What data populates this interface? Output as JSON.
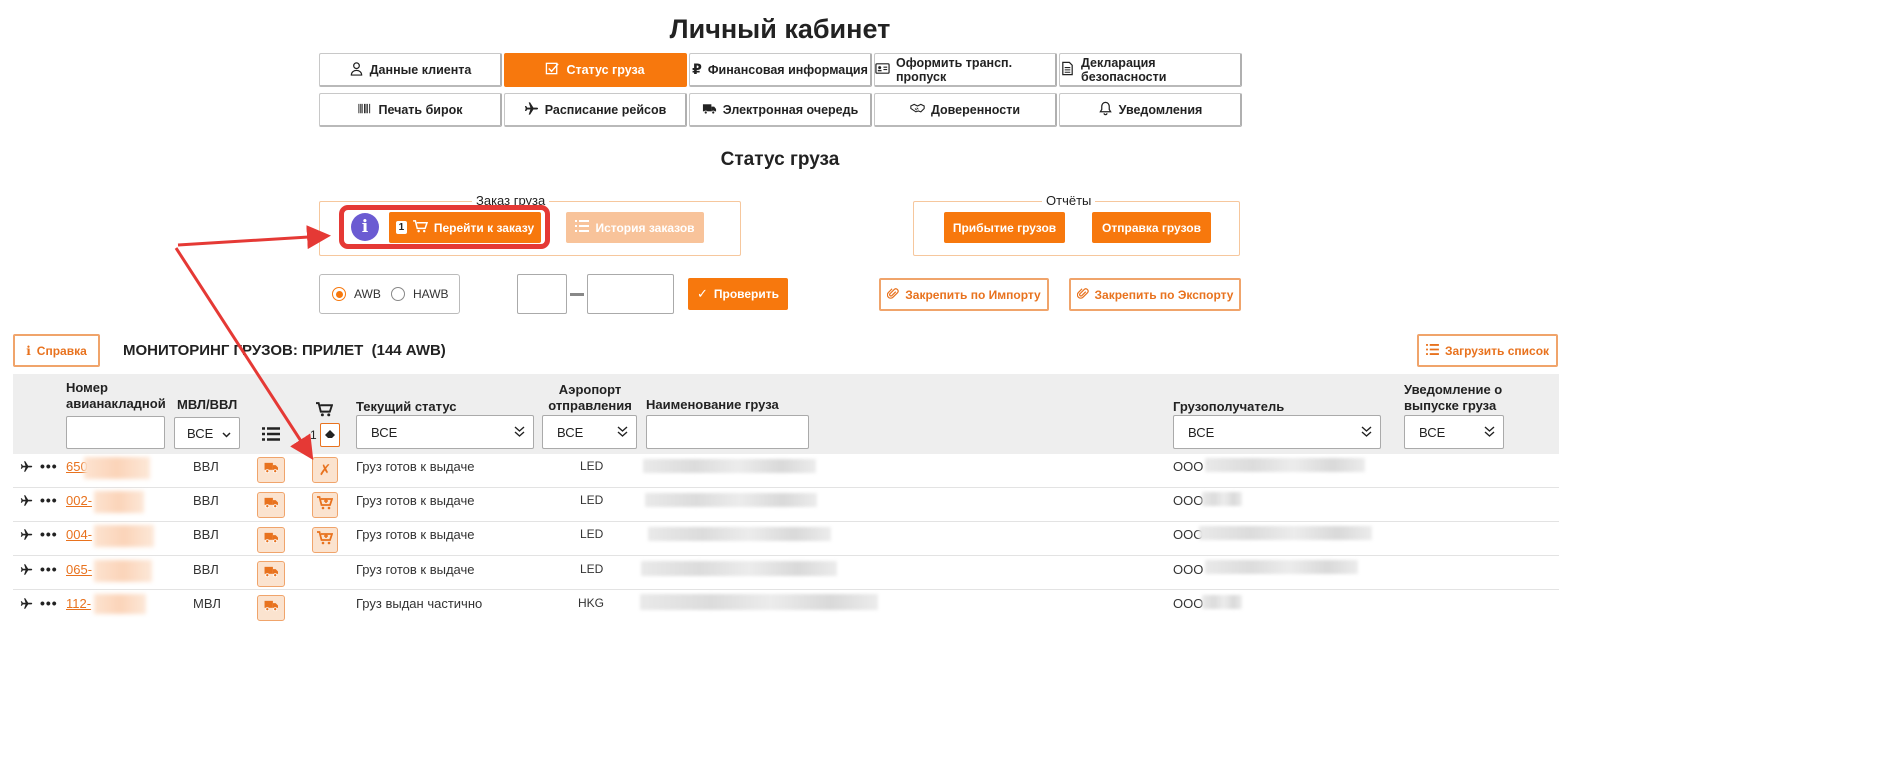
{
  "page": {
    "title": "Личный кабинет",
    "section_title": "Статус груза"
  },
  "tabs": [
    {
      "label": "Данные клиента",
      "icon": "user-icon",
      "active": false
    },
    {
      "label": "Статус груза",
      "icon": "checkbox-icon",
      "active": true
    },
    {
      "label": "Финансовая информация",
      "icon": "ruble-icon",
      "active": false
    },
    {
      "label": "Оформить трансп. пропуск",
      "icon": "id-card-icon",
      "active": false
    },
    {
      "label": "Декларация безопасности",
      "icon": "document-icon",
      "active": false
    },
    {
      "label": "Печать бирок",
      "icon": "barcode-icon",
      "active": false
    },
    {
      "label": "Расписание рейсов",
      "icon": "plane-icon",
      "active": false
    },
    {
      "label": "Электронная очередь",
      "icon": "truck-icon",
      "active": false
    },
    {
      "label": "Доверенности",
      "icon": "handshake-icon",
      "active": false
    },
    {
      "label": "Уведомления",
      "icon": "bell-icon",
      "active": false
    }
  ],
  "order": {
    "legend": "Заказ груза",
    "badge": "1",
    "goto_label": "Перейти к заказу",
    "history_label": "История заказов"
  },
  "reports": {
    "legend": "Отчёты",
    "arrival_label": "Прибытие грузов",
    "departure_label": "Отправка грузов"
  },
  "search": {
    "radio_awb": "AWB",
    "radio_hawb": "HAWB",
    "selected": "AWB",
    "check_label": "Проверить",
    "pin_import": "Закрепить по Импорту",
    "pin_export": "Закрепить по Экспорту"
  },
  "monitor": {
    "help_label": "Справка",
    "title": "МОНИТОРИНГ ГРУЗОВ: ПРИЛЕТ  (144 AWB)",
    "load_list_label": "Загрузить список",
    "cart_count": "1"
  },
  "columns": {
    "awb": "Номер авианакладной",
    "mvl": "МВЛ/ВВЛ",
    "status": "Текущий статус",
    "airport": "Аэропорт отправления",
    "cargo_name": "Наименование груза",
    "consignee": "Грузополучатель",
    "notice": "Уведомление о выпуске груза"
  },
  "filters": {
    "mvl": "ВСЕ",
    "status": "ВСЕ",
    "airport": "ВСЕ",
    "consignee": "ВСЕ",
    "notice": "ВСЕ"
  },
  "rows": [
    {
      "awb": "650",
      "type": "ВВЛ",
      "status": "Груз готов к выдаче",
      "airport": "LED",
      "consignee": "ООО '",
      "cart": "remove"
    },
    {
      "awb": "002-",
      "type": "ВВЛ",
      "status": "Груз готов к выдаче",
      "airport": "LED",
      "consignee": "ООО",
      "cart": "add"
    },
    {
      "awb": "004-",
      "type": "ВВЛ",
      "status": "Груз готов к выдаче",
      "airport": "LED",
      "consignee": "ООО",
      "cart": "add"
    },
    {
      "awb": "065-",
      "type": "ВВЛ",
      "status": "Груз готов к выдаче",
      "airport": "LED",
      "consignee": "ООО",
      "cart": "none"
    },
    {
      "awb": "112-",
      "type": "МВЛ",
      "status": "Груз выдан частично",
      "airport": "HKG",
      "consignee": "ООО",
      "cart": "none"
    }
  ],
  "colors": {
    "accent": "#f7780d",
    "annotation": "#e53935"
  }
}
